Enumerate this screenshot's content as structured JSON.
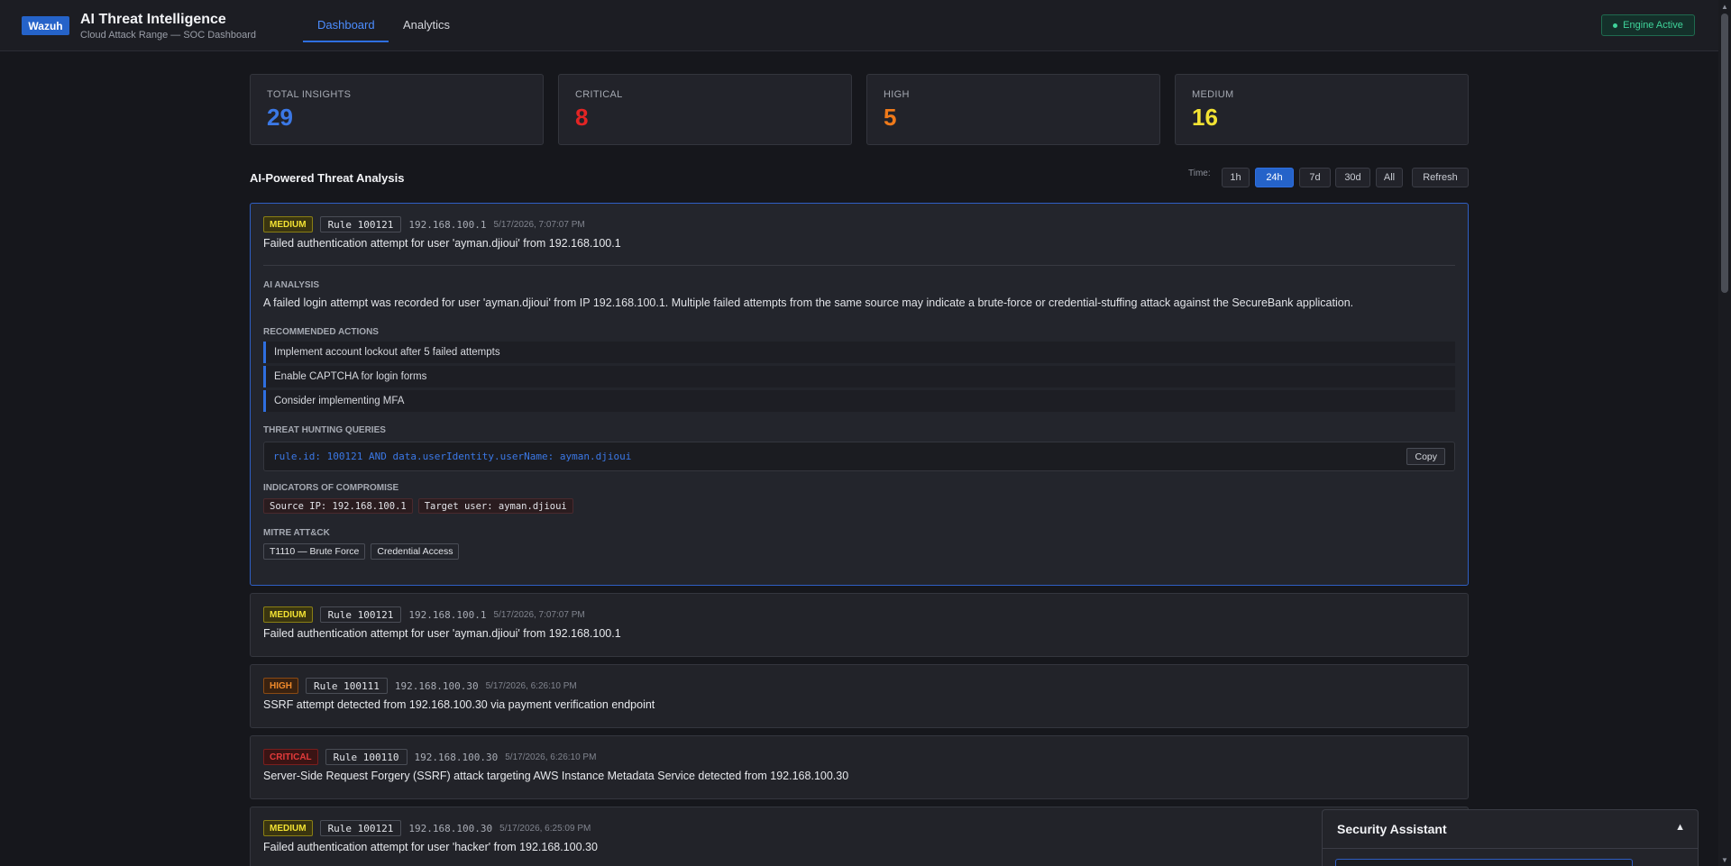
{
  "header": {
    "logo": "Wazuh",
    "title": "AI Threat Intelligence",
    "subtitle": "Cloud Attack Range — SOC Dashboard",
    "tabs": [
      {
        "label": "Dashboard",
        "active": true
      },
      {
        "label": "Analytics",
        "active": false
      }
    ],
    "status": "Engine Active",
    "status_color": "#3fd39a"
  },
  "stats": [
    {
      "label": "Total Insights",
      "value": "29",
      "color": "#3b78e6"
    },
    {
      "label": "Critical",
      "value": "8",
      "color": "#e32424"
    },
    {
      "label": "High",
      "value": "5",
      "color": "#f07a1a"
    },
    {
      "label": "Medium",
      "value": "16",
      "color": "#f2e233"
    }
  ],
  "section": {
    "title": "AI-Powered Threat Analysis",
    "time_label": "Time:",
    "time_options": [
      "1h",
      "24h",
      "7d",
      "30d",
      "All"
    ],
    "time_selected": "24h",
    "refresh": "Refresh"
  },
  "insights": [
    {
      "severity": "MEDIUM",
      "rule": "Rule 100121",
      "ip": "192.168.100.1",
      "timestamp": "5/17/2026, 7:07:07 PM",
      "title": "Failed authentication attempt for user 'ayman.djioui' from 192.168.100.1",
      "expanded": true,
      "ai_analysis_label": "AI ANALYSIS",
      "ai_analysis": "A failed login attempt was recorded for user 'ayman.djioui' from IP 192.168.100.1. Multiple failed attempts from the same source may indicate a brute-force or credential-stuffing attack against the SecureBank application.",
      "actions_label": "RECOMMENDED ACTIONS",
      "actions": [
        "Implement account lockout after 5 failed attempts",
        "Enable CAPTCHA for login forms",
        "Consider implementing MFA"
      ],
      "queries_label": "THREAT HUNTING QUERIES",
      "query": "rule.id: 100121 AND data.userIdentity.userName: ayman.djioui",
      "copy_label": "Copy",
      "ioc_label": "INDICATORS OF COMPROMISE",
      "iocs": [
        "Source IP: 192.168.100.1",
        "Target user: ayman.djioui"
      ],
      "mitre_label": "MITRE ATT&CK",
      "mitre": [
        "T1110 — Brute Force",
        "Credential Access"
      ]
    },
    {
      "severity": "MEDIUM",
      "rule": "Rule 100121",
      "ip": "192.168.100.1",
      "timestamp": "5/17/2026, 7:07:07 PM",
      "title": "Failed authentication attempt for user 'ayman.djioui' from 192.168.100.1"
    },
    {
      "severity": "HIGH",
      "rule": "Rule 100111",
      "ip": "192.168.100.30",
      "timestamp": "5/17/2026, 6:26:10 PM",
      "title": "SSRF attempt detected from 192.168.100.30 via payment verification endpoint"
    },
    {
      "severity": "CRITICAL",
      "rule": "Rule 100110",
      "ip": "192.168.100.30",
      "timestamp": "5/17/2026, 6:26:10 PM",
      "title": "Server-Side Request Forgery (SSRF) attack targeting AWS Instance Metadata Service detected from 192.168.100.30"
    },
    {
      "severity": "MEDIUM",
      "rule": "Rule 100121",
      "ip": "192.168.100.30",
      "timestamp": "5/17/2026, 6:25:09 PM",
      "title": "Failed authentication attempt for user 'hacker' from 192.168.100.30"
    }
  ],
  "assistant": {
    "title": "Security Assistant",
    "toggle_icon": "▲"
  }
}
